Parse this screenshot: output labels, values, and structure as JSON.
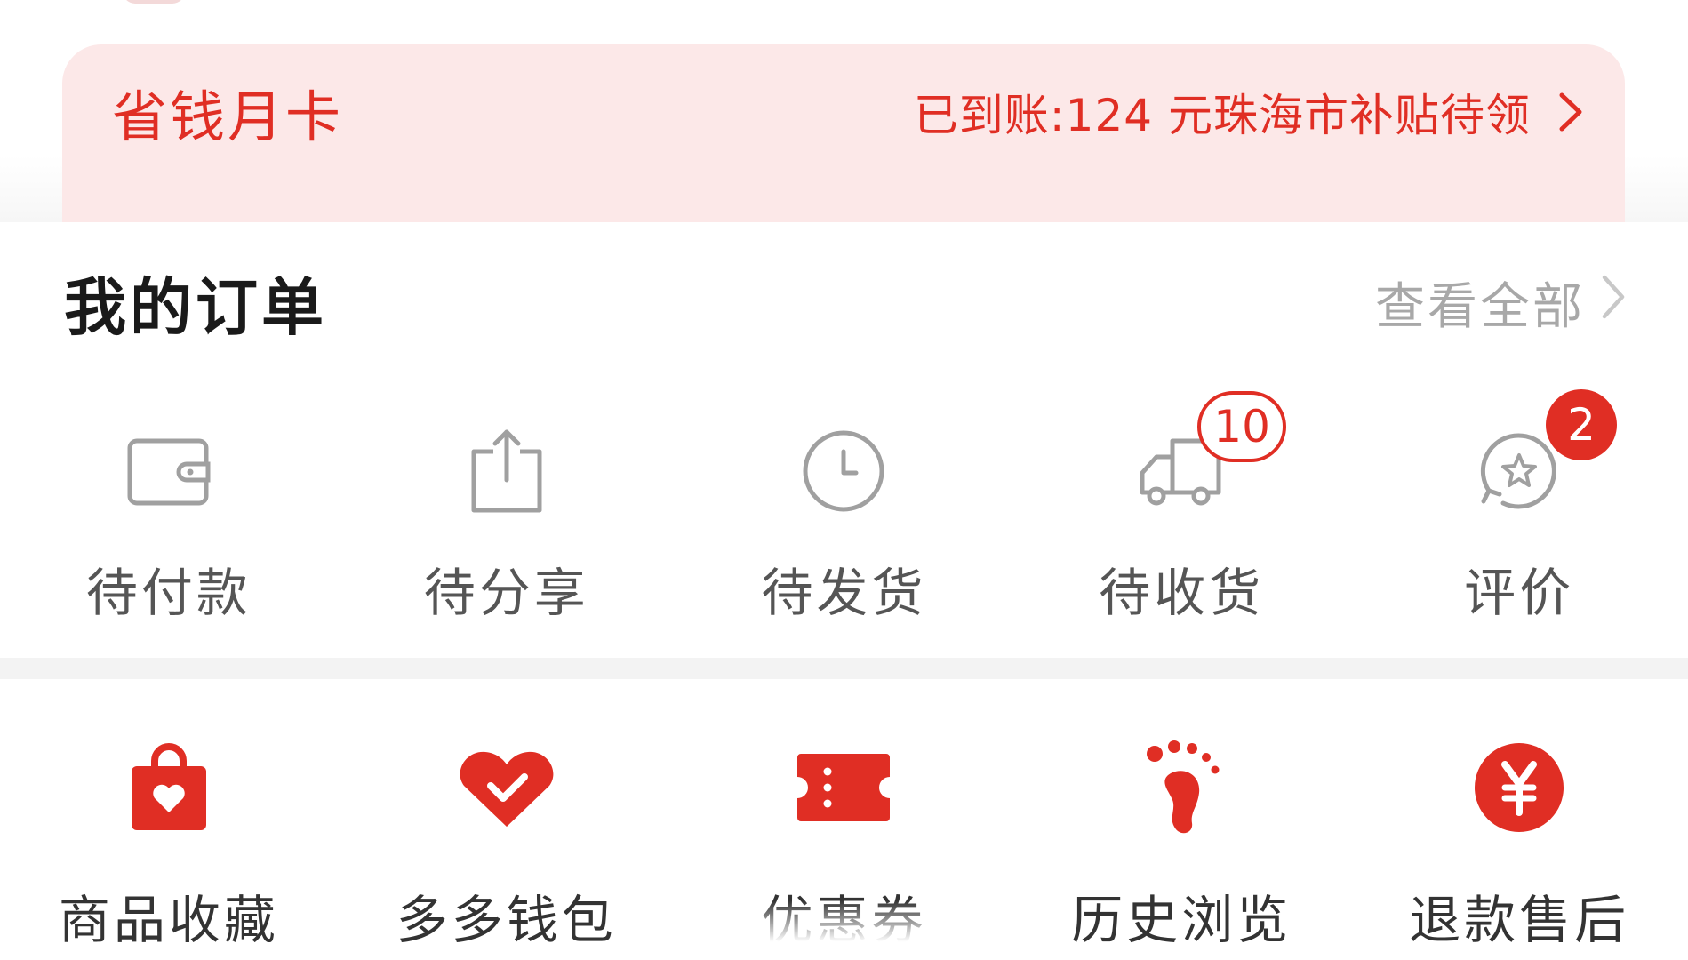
{
  "colors": {
    "accent": "#e02e24",
    "banner_bg": "#fce8e8",
    "muted_text": "#a8a8a8",
    "icon_gray": "#a0a0a0"
  },
  "card": {
    "title": "省钱月卡",
    "subsidy": "已到账:124 元珠海市补贴待领",
    "chevron_icon": "chevron-right-icon"
  },
  "orders": {
    "title": "我的订单",
    "view_all": "查看全部",
    "items": [
      {
        "label": "待付款",
        "icon": "wallet-icon"
      },
      {
        "label": "待分享",
        "icon": "share-icon"
      },
      {
        "label": "待发货",
        "icon": "clock-icon"
      },
      {
        "label": "待收货",
        "icon": "truck-icon",
        "badge": "10"
      },
      {
        "label": "评价",
        "icon": "review-star-icon",
        "badge": "2"
      }
    ]
  },
  "features": {
    "items": [
      {
        "label": "商品收藏",
        "icon": "favorites-bag-icon"
      },
      {
        "label": "多多钱包",
        "icon": "wallet-heart-icon"
      },
      {
        "label": "优惠券",
        "icon": "coupon-ticket-icon"
      },
      {
        "label": "历史浏览",
        "icon": "footprint-icon"
      },
      {
        "label": "退款售后",
        "icon": "refund-yen-icon"
      }
    ]
  }
}
